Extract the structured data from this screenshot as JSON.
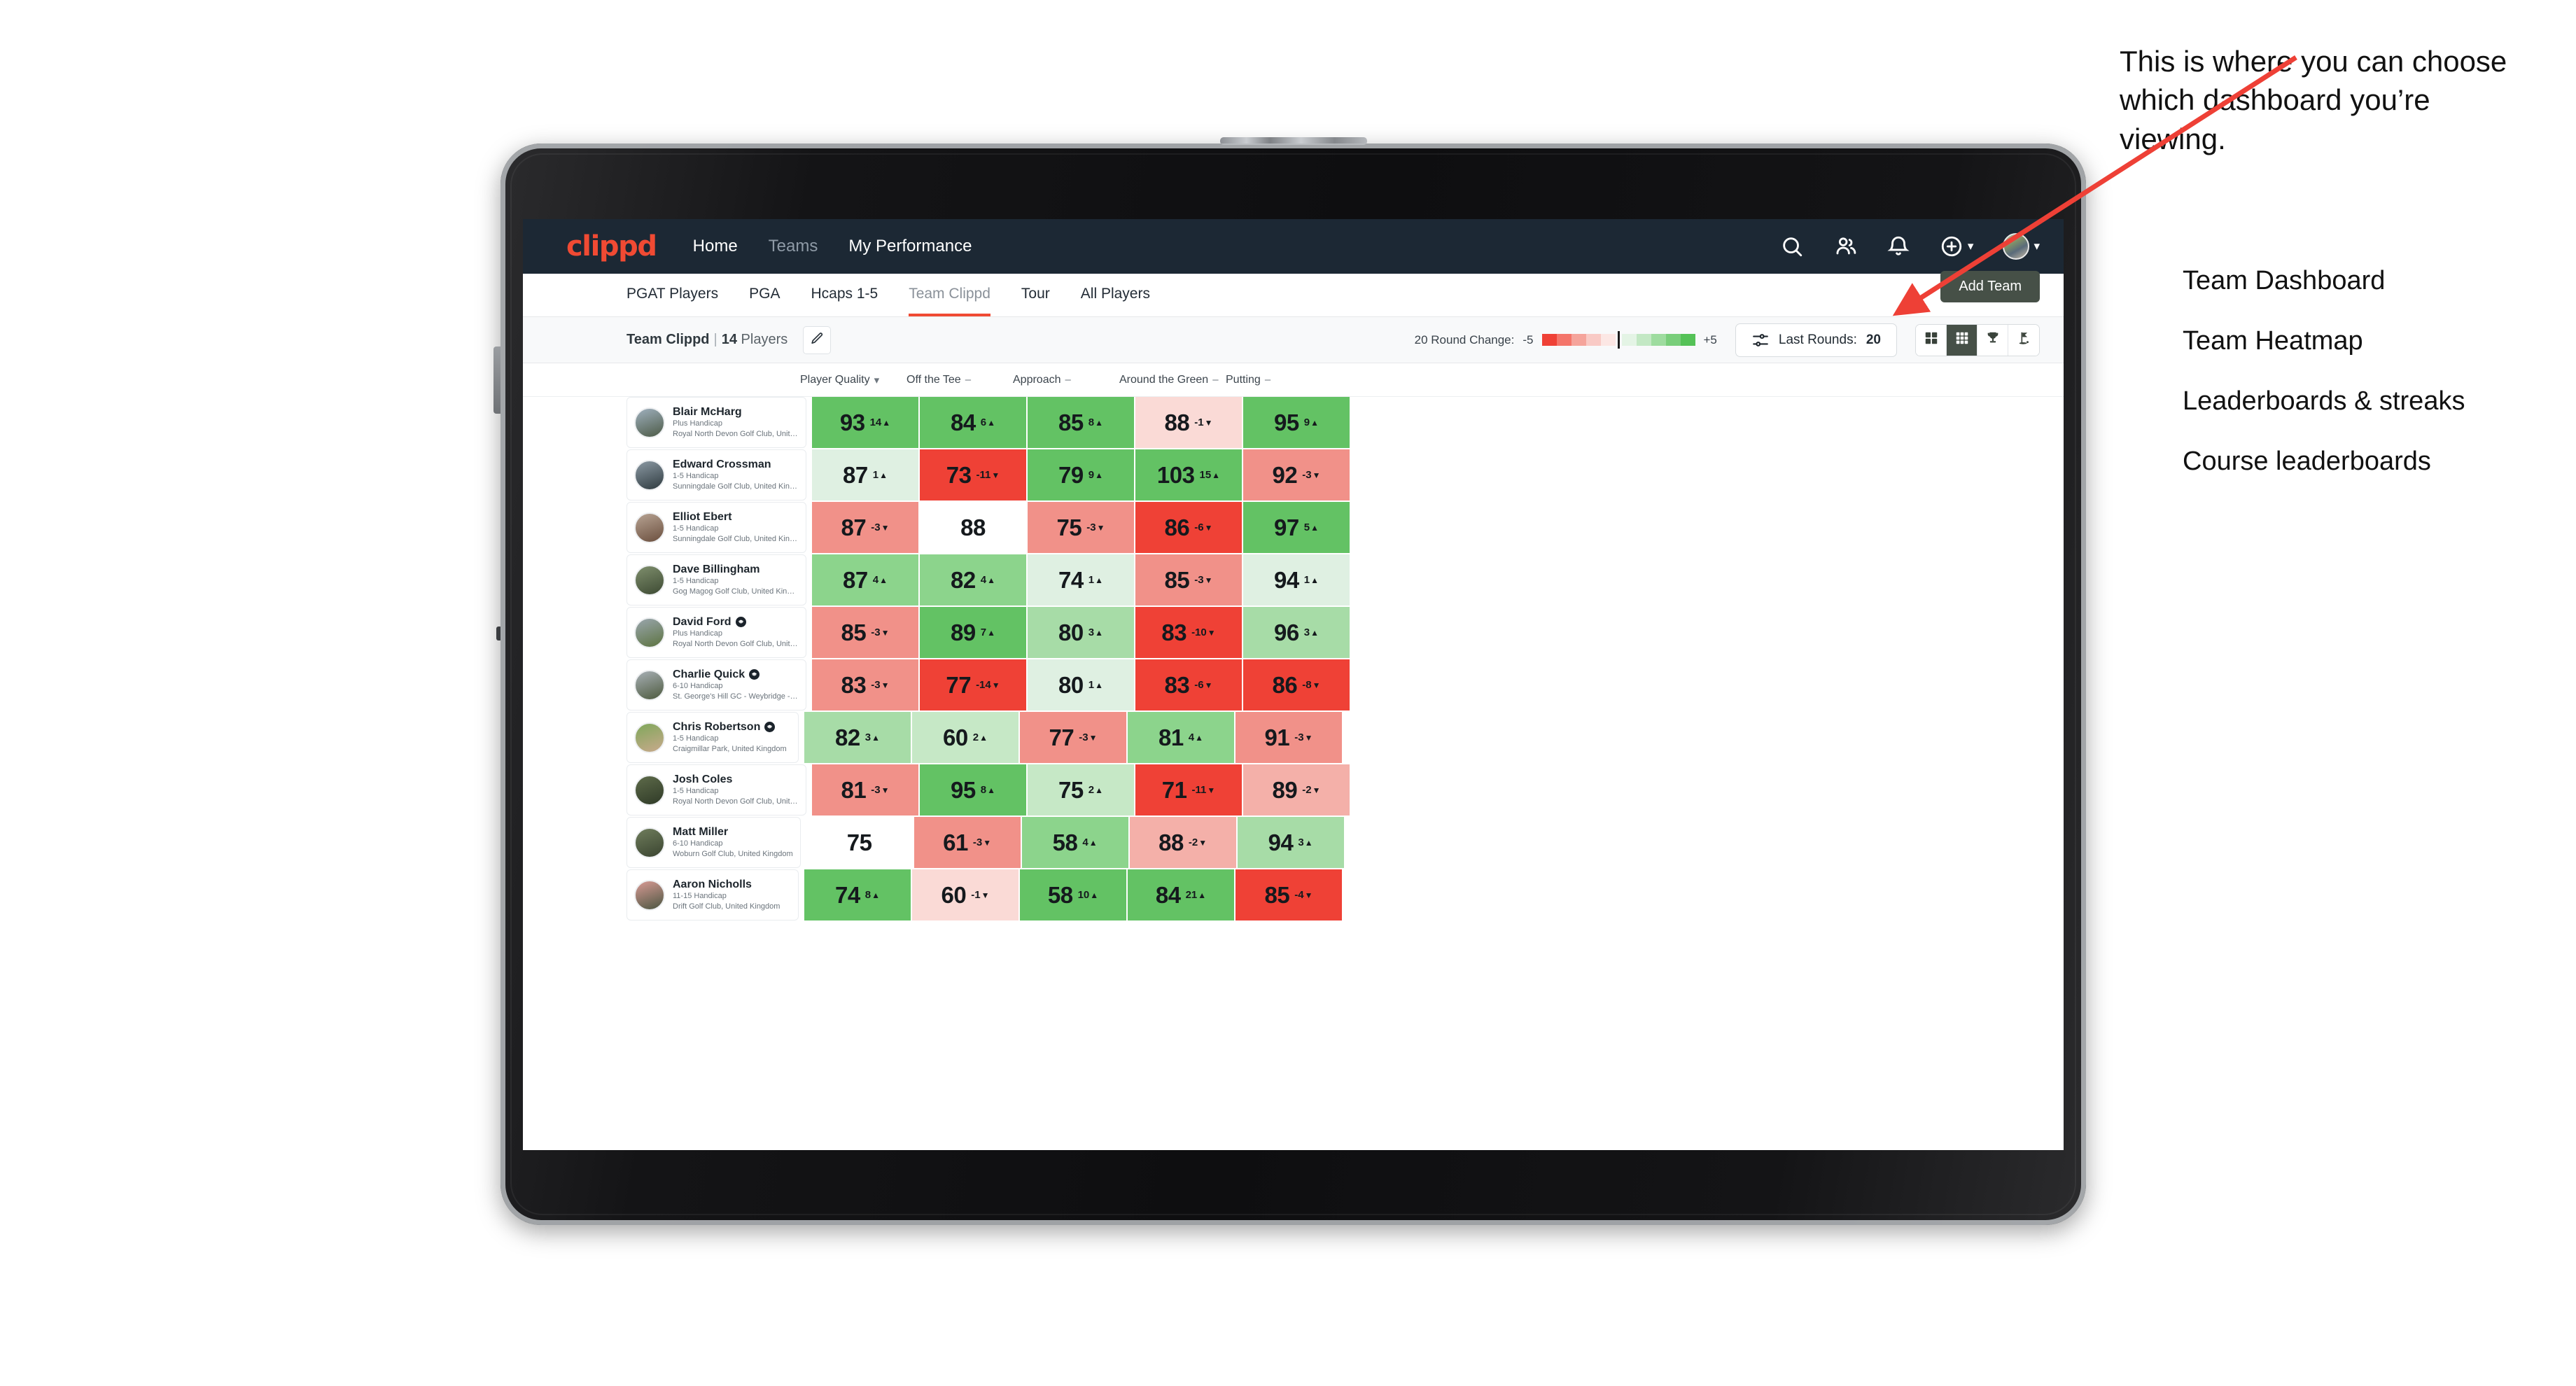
{
  "nav": {
    "brand": "clippd",
    "links": [
      {
        "label": "Home",
        "active": true
      },
      {
        "label": "Teams",
        "active": false
      },
      {
        "label": "My Performance",
        "active": true
      }
    ],
    "icons": [
      "search-icon",
      "people-icon",
      "bell-icon",
      "plus-circle-icon",
      "avatar"
    ]
  },
  "tabs": [
    {
      "label": "PGAT Players",
      "active": false
    },
    {
      "label": "PGA",
      "active": false
    },
    {
      "label": "Hcaps 1-5",
      "active": false
    },
    {
      "label": "Team Clippd",
      "active": true
    },
    {
      "label": "Tour",
      "active": false
    },
    {
      "label": "All Players",
      "active": false
    }
  ],
  "add_team_label": "Add Team",
  "toolbar": {
    "team_name": "Team Clippd",
    "separator": "|",
    "player_count": "14",
    "players_word": "Players",
    "edit_icon": "pencil-icon",
    "round_change_label": "20 Round Change:",
    "scale_min": "-5",
    "scale_max": "+5",
    "last_rounds_label": "Last Rounds:",
    "last_rounds_value": "20",
    "view_toggles": [
      {
        "name": "team-dashboard",
        "icon": "grid-2x2-icon",
        "active": false
      },
      {
        "name": "team-heatmap",
        "icon": "grid-3x3-icon",
        "active": true
      },
      {
        "name": "leaderboards-streaks",
        "icon": "trophy-icon",
        "active": false
      },
      {
        "name": "course-leaderboards",
        "icon": "golf-flag-icon",
        "active": false
      }
    ]
  },
  "columns": [
    {
      "label": "Player Quality",
      "mark": "chevron-down"
    },
    {
      "label": "Off the Tee",
      "mark": "dash"
    },
    {
      "label": "Approach",
      "mark": "dash"
    },
    {
      "label": "Around the Green",
      "mark": "dash"
    },
    {
      "label": "Putting",
      "mark": "dash"
    }
  ],
  "chart_data": {
    "type": "heatmap",
    "title": "Team Clippd | 14 Players",
    "xlabel": "",
    "ylabel": "",
    "categories": [
      "Player Quality",
      "Off the Tee",
      "Approach",
      "Around the Green",
      "Putting"
    ],
    "legend": {
      "label": "20 Round Change:",
      "min": "-5",
      "max": "+5",
      "position": "top-right"
    },
    "rows": [
      {
        "player": "Blair McHarg",
        "handicap": "Plus Handicap",
        "club": "Royal North Devon Golf Club, United Kingdom",
        "badge": false,
        "avatar_colors": [
          "#9fb0be",
          "#4c5a46"
        ],
        "values": [
          93,
          84,
          85,
          88,
          95
        ],
        "deltas": [
          "14",
          "6",
          "8",
          "-1",
          "9"
        ],
        "dirs": [
          "up",
          "up",
          "up",
          "down",
          "up"
        ],
        "colors": [
          "#63c264",
          "#63c264",
          "#63c264",
          "#fadad6",
          "#63c264"
        ]
      },
      {
        "player": "Edward Crossman",
        "handicap": "1-5 Handicap",
        "club": "Sunningdale Golf Club, United Kingdom",
        "badge": false,
        "avatar_colors": [
          "#8c9aa4",
          "#2e3a3f"
        ],
        "values": [
          87,
          73,
          79,
          103,
          92
        ],
        "deltas": [
          "1",
          "-11",
          "9",
          "15",
          "-3"
        ],
        "dirs": [
          "up",
          "down",
          "up",
          "up",
          "down"
        ],
        "colors": [
          "#dff0e2",
          "#ef4136",
          "#63c264",
          "#63c264",
          "#f19189"
        ]
      },
      {
        "player": "Elliot Ebert",
        "handicap": "1-5 Handicap",
        "club": "Sunningdale Golf Club, United Kingdom",
        "badge": false,
        "avatar_colors": [
          "#b7a393",
          "#6b4f3e"
        ],
        "values": [
          87,
          88,
          75,
          86,
          97
        ],
        "deltas": [
          "-3",
          "",
          "-3",
          "-6",
          "5"
        ],
        "dirs": [
          "down",
          "none",
          "down",
          "down",
          "up"
        ],
        "colors": [
          "#f19189",
          "#ffffff",
          "#f19189",
          "#ef4136",
          "#63c264"
        ]
      },
      {
        "player": "Dave Billingham",
        "handicap": "1-5 Handicap",
        "club": "Gog Magog Golf Club, United Kingdom",
        "badge": false,
        "avatar_colors": [
          "#7f8f6d",
          "#3d4a33"
        ],
        "values": [
          87,
          82,
          74,
          85,
          94
        ],
        "deltas": [
          "4",
          "4",
          "1",
          "-3",
          "1"
        ],
        "dirs": [
          "up",
          "up",
          "up",
          "down",
          "up"
        ],
        "colors": [
          "#8cd48c",
          "#8cd48c",
          "#dff0e2",
          "#f19189",
          "#dff0e2"
        ]
      },
      {
        "player": "David Ford",
        "handicap": "Plus Handicap",
        "club": "Royal North Devon Golf Club, United Kingdom",
        "badge": true,
        "avatar_colors": [
          "#9aa6ae",
          "#5c7340"
        ],
        "values": [
          85,
          89,
          80,
          83,
          96
        ],
        "deltas": [
          "-3",
          "7",
          "3",
          "-10",
          "3"
        ],
        "dirs": [
          "down",
          "up",
          "up",
          "down",
          "up"
        ],
        "colors": [
          "#f19189",
          "#63c264",
          "#a7dca7",
          "#ef4136",
          "#a7dca7"
        ]
      },
      {
        "player": "Charlie Quick",
        "handicap": "6-10 Handicap",
        "club": "St. George's Hill GC - Weybridge - Surrey, Uni...",
        "badge": true,
        "avatar_colors": [
          "#a8b0b6",
          "#4d5a3e"
        ],
        "values": [
          83,
          77,
          80,
          83,
          86
        ],
        "deltas": [
          "-3",
          "-14",
          "1",
          "-6",
          "-8"
        ],
        "dirs": [
          "down",
          "down",
          "up",
          "down",
          "down"
        ],
        "colors": [
          "#f19189",
          "#ef4136",
          "#dff0e2",
          "#ef4136",
          "#ef4136"
        ]
      },
      {
        "player": "Chris Robertson",
        "handicap": "1-5 Handicap",
        "club": "Craigmillar Park, United Kingdom",
        "badge": true,
        "avatar_colors": [
          "#7fa85a",
          "#c9a98c"
        ],
        "values": [
          82,
          60,
          77,
          81,
          91
        ],
        "deltas": [
          "3",
          "2",
          "-3",
          "4",
          "-3"
        ],
        "dirs": [
          "up",
          "up",
          "down",
          "up",
          "down"
        ],
        "colors": [
          "#a7dca7",
          "#c6e8c6",
          "#f19189",
          "#8cd48c",
          "#f19189"
        ]
      },
      {
        "player": "Josh Coles",
        "handicap": "1-5 Handicap",
        "club": "Royal North Devon Golf Club, United Kingdom",
        "badge": false,
        "avatar_colors": [
          "#5e6b4a",
          "#2f3a27"
        ],
        "values": [
          81,
          95,
          75,
          71,
          89
        ],
        "deltas": [
          "-3",
          "8",
          "2",
          "-11",
          "-2"
        ],
        "dirs": [
          "down",
          "up",
          "up",
          "down",
          "down"
        ],
        "colors": [
          "#f19189",
          "#63c264",
          "#c6e8c6",
          "#ef4136",
          "#f4b0a9"
        ]
      },
      {
        "player": "Matt Miller",
        "handicap": "6-10 Handicap",
        "club": "Woburn Golf Club, United Kingdom",
        "badge": false,
        "avatar_colors": [
          "#6f7d5c",
          "#3a4430"
        ],
        "values": [
          75,
          61,
          58,
          88,
          94
        ],
        "deltas": [
          "",
          "-3",
          "4",
          "-2",
          "3"
        ],
        "dirs": [
          "none",
          "down",
          "up",
          "down",
          "up"
        ],
        "colors": [
          "#ffffff",
          "#f19189",
          "#8cd48c",
          "#f4b0a9",
          "#a7dca7"
        ]
      },
      {
        "player": "Aaron Nicholls",
        "handicap": "11-15 Handicap",
        "club": "Drift Golf Club, United Kingdom",
        "badge": false,
        "avatar_colors": [
          "#d99b95",
          "#4a5540"
        ],
        "values": [
          74,
          60,
          58,
          84,
          85
        ],
        "deltas": [
          "8",
          "-1",
          "10",
          "21",
          "-4"
        ],
        "dirs": [
          "up",
          "down",
          "up",
          "up",
          "down"
        ],
        "colors": [
          "#63c264",
          "#fadad6",
          "#63c264",
          "#63c264",
          "#ef4136"
        ]
      }
    ]
  },
  "annotation": {
    "paragraph": "This is where you can choose which dashboard you’re viewing.",
    "items": [
      "Team Dashboard",
      "Team Heatmap",
      "Leaderboards & streaks",
      "Course leaderboards"
    ],
    "arrow_color": "#ee4036"
  }
}
